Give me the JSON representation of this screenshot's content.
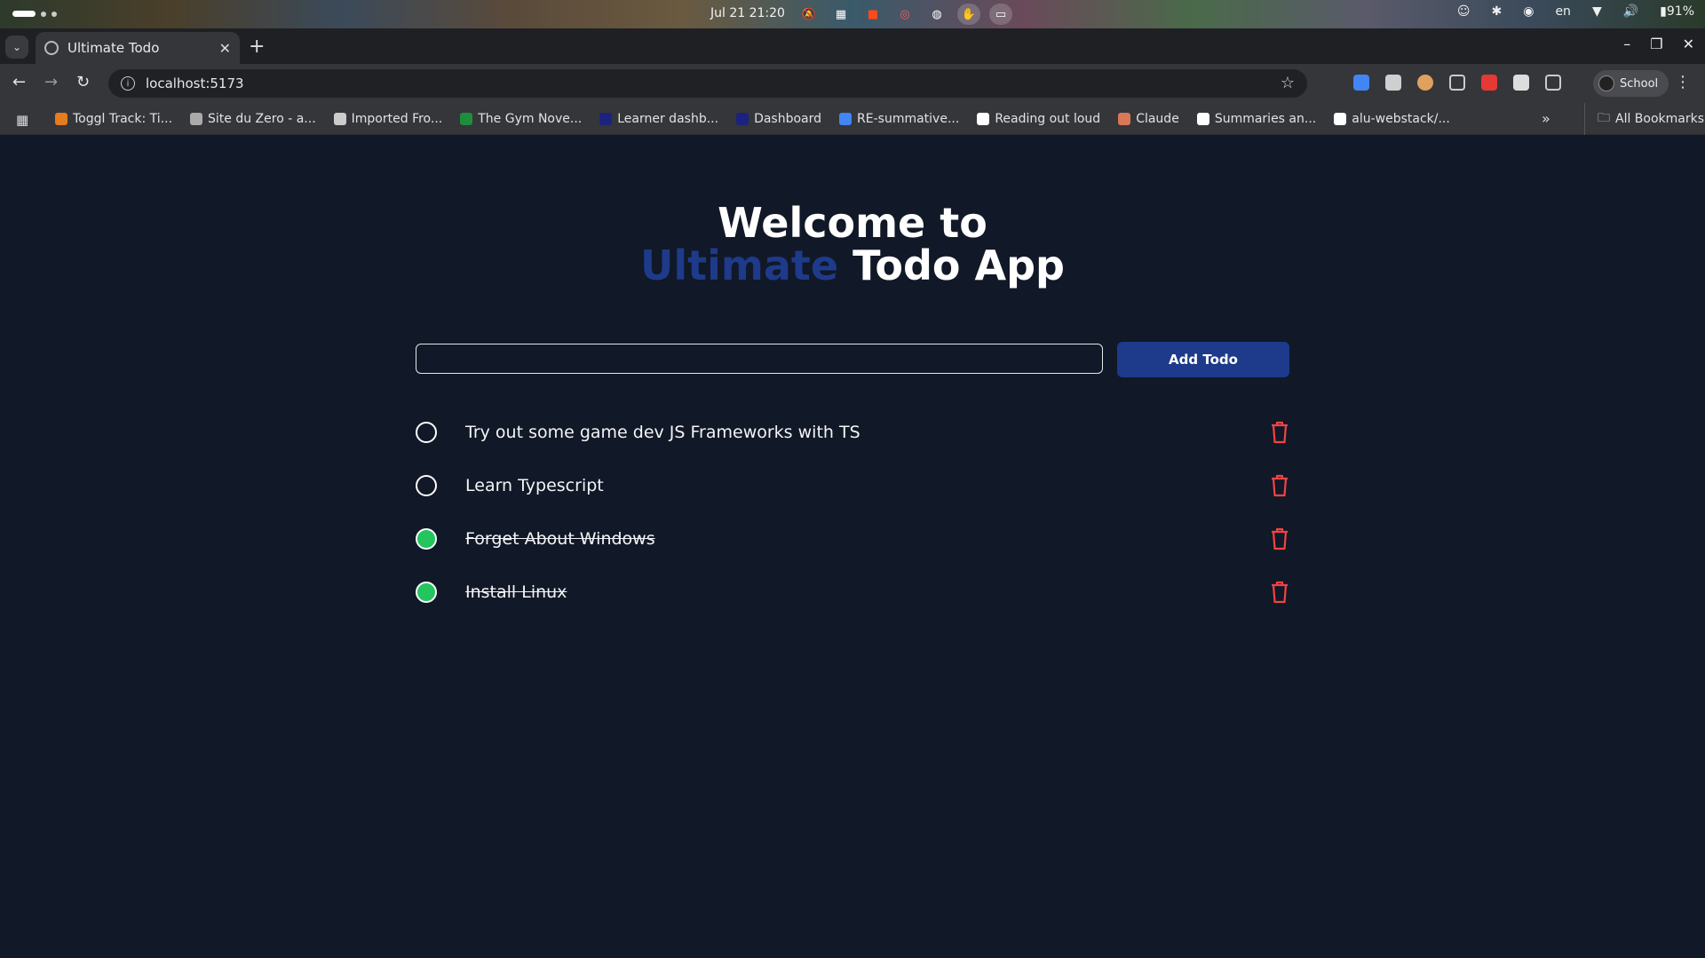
{
  "os": {
    "clock": "Jul 21  21:20",
    "lang": "en",
    "battery": "91%"
  },
  "browser": {
    "tab_title": "Ultimate Todo",
    "url": "localhost:5173",
    "profile": "School",
    "bookmarks": [
      {
        "label": "Toggl Track: Ti...",
        "icon": "toggl-icon",
        "color": "#e57c1f"
      },
      {
        "label": "Site du Zero - a...",
        "icon": "globe-icon",
        "color": "#aaaaaa"
      },
      {
        "label": "Imported Fro...",
        "icon": "folder-icon",
        "color": "#cccccc"
      },
      {
        "label": "The Gym Nove...",
        "icon": "sheets-icon",
        "color": "#1e8e3e"
      },
      {
        "label": "Learner dashb...",
        "icon": "learner-icon",
        "color": "#1a237e"
      },
      {
        "label": "Dashboard",
        "icon": "dashboard-icon",
        "color": "#1a237e"
      },
      {
        "label": "RE-summative...",
        "icon": "docs-icon",
        "color": "#4285f4"
      },
      {
        "label": "Reading out loud",
        "icon": "notion-icon",
        "color": "#ffffff"
      },
      {
        "label": "Claude",
        "icon": "claude-icon",
        "color": "#d97757"
      },
      {
        "label": "Summaries an...",
        "icon": "notion-icon",
        "color": "#ffffff"
      },
      {
        "label": "alu-webstack/...",
        "icon": "github-icon",
        "color": "#ffffff"
      }
    ],
    "all_bookmarks": "All Bookmarks"
  },
  "app": {
    "heading_line1": "Welcome to",
    "heading_accent": "Ultimate",
    "heading_rest": " Todo App",
    "input_value": "",
    "add_button": "Add Todo",
    "todos": [
      {
        "text": "Try out some game dev JS Frameworks with TS",
        "done": false
      },
      {
        "text": "Learn Typescript",
        "done": false
      },
      {
        "text": "Forget About Windows",
        "done": true
      },
      {
        "text": "Install Linux",
        "done": true
      }
    ]
  },
  "colors": {
    "background": "#111827",
    "accent": "#1e3a8a",
    "done": "#22c55e",
    "trash": "#ef4444"
  }
}
